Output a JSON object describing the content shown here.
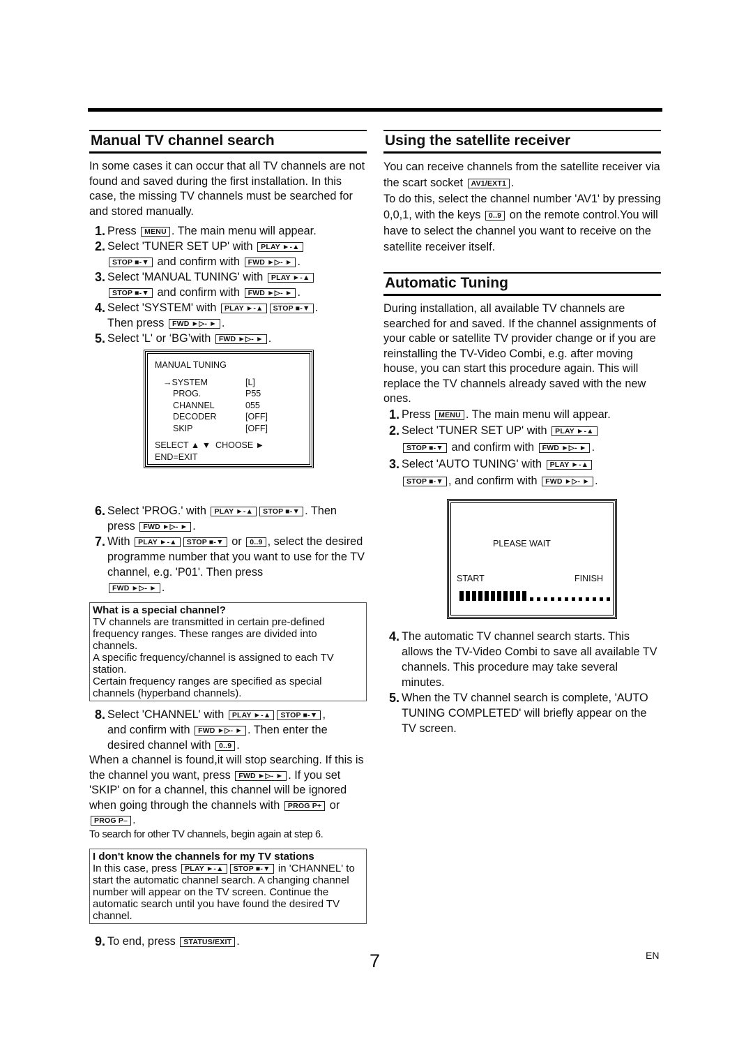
{
  "page": {
    "number": "7",
    "language": "EN"
  },
  "keys": {
    "menu": "MENU",
    "play": "PLAY ►-▲",
    "stop": "STOP ■-▼",
    "fwd": "FWD ►▷- ►",
    "digits": "0..9",
    "av1": "AV1/EXT1",
    "prog_plus": "PROG P+",
    "prog_minus": "PROG P–",
    "status_exit": "STATUS/EXIT"
  },
  "manual": {
    "title": "Manual TV channel search",
    "intro": "In some cases it can occur that all TV channels are not found and saved during the first installation. In this case, the missing TV channels must be searched for and stored manually.",
    "steps": [
      {
        "num": "1.",
        "a": "Press",
        "b": ". The main menu will appear."
      },
      {
        "num": "2.",
        "a": "Select 'TUNER SET UP' with",
        "b": "and confirm with",
        "c": "."
      },
      {
        "num": "3.",
        "a": "Select 'MANUAL TUNING' with",
        "b": "and confirm with",
        "c": "."
      },
      {
        "num": "4.",
        "a": "Select 'SYSTEM' with",
        "b": ".",
        "c": "Then press",
        "d": "."
      },
      {
        "num": "5.",
        "a": "Select 'L' or ‘BG’with",
        "b": "."
      },
      {
        "num": "6.",
        "a": "Select 'PROG.' with",
        "b": ". Then",
        "c": "press",
        "d": "."
      },
      {
        "num": "7.",
        "a": "With",
        "b": "or",
        "c": ", select the desired programme number that you want to use for the TV channel, e.g. 'P01'. Then press",
        "d": "."
      },
      {
        "num": "8.",
        "a": "Select 'CHANNEL' with",
        "b": ",",
        "c": "and confirm with",
        "d": ". Then enter the desired channel with",
        "e": "."
      },
      {
        "num": "9.",
        "a": "To end, press",
        "b": "."
      }
    ],
    "osd": {
      "title": "MANUAL TUNING",
      "cursor": "→",
      "rows": [
        {
          "label": "SYSTEM",
          "value": "[L]",
          "selected": true
        },
        {
          "label": "PROG.",
          "value": "P55"
        },
        {
          "label": "CHANNEL",
          "value": "055"
        },
        {
          "label": "DECODER",
          "value": "[OFF]"
        },
        {
          "label": "SKIP",
          "value": "[OFF]"
        }
      ],
      "footer1": "SELECT ▲ ▼  CHOOSE ►",
      "footer2": "END=EXIT"
    },
    "special_note": {
      "title": "What is a special channel?",
      "lines": [
        "TV channels are transmitted in certain pre-defined frequency ranges. These ranges are divided into channels.",
        "A specific frequency/channel is assigned to each TV station.",
        "Certain frequency ranges are specified as special channels (hyperband channels)."
      ]
    },
    "after8": {
      "a": "When a channel is found,it will stop searching. If this is the channel you want, press",
      "b": ". If you set 'SKIP' on for a channel, this channel will be ignored when going through the channels with",
      "c": "or",
      "d": ".",
      "e": "To search for other TV channels, begin again at step 6."
    },
    "unknown_note": {
      "title": "I don't know the channels for my TV stations",
      "a": "In this case, press",
      "b": "in 'CHANNEL' to start the automatic channel search. A changing channel number will appear on the TV screen. Continue the automatic search until you have found the desired TV channel."
    }
  },
  "satellite": {
    "title": "Using the satellite receiver",
    "a": "You can receive channels from the satellite receiver via the scart socket",
    "b": ".",
    "c": "To do this, select the channel number 'AV1' by pressing 0,0,1, with the keys",
    "d": "on the remote control.You will have to select the channel you want to receive on the satellite receiver itself."
  },
  "auto": {
    "title": "Automatic Tuning",
    "intro": "During installation, all available TV channels are searched for and saved. If the channel assignments of your cable or satellite TV provider change or if you are reinstalling the TV-Video Combi, e.g. after moving house, you can start this procedure again. This will replace the TV channels already saved with the new ones.",
    "steps": [
      {
        "num": "1.",
        "a": "Press",
        "b": ". The main menu will appear."
      },
      {
        "num": "2.",
        "a": "Select 'TUNER SET UP' with",
        "b": "and confirm with",
        "c": "."
      },
      {
        "num": "3.",
        "a": "Select 'AUTO TUNING' with",
        "b": ", and confirm with",
        "c": "."
      },
      {
        "num": "4.",
        "a": "The automatic TV channel search starts. This allows the TV-Video Combi to save all available TV channels. This procedure may take several minutes."
      },
      {
        "num": "5.",
        "a": "When the TV channel search is complete, 'AUTO TUNING COMPLETED' will briefly appear on the TV screen."
      }
    ],
    "osd": {
      "message": "PLEASE WAIT",
      "start": "START",
      "finish": "FINISH",
      "progress_filled": 11,
      "progress_total": 23
    }
  }
}
